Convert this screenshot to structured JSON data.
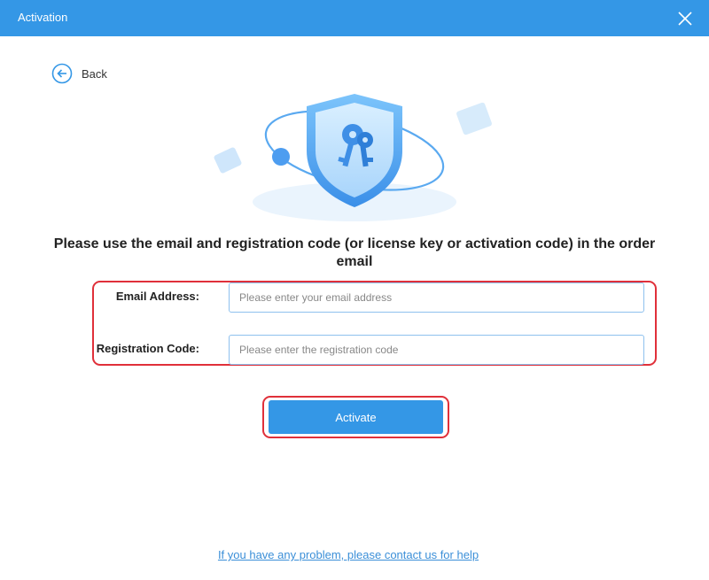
{
  "window": {
    "title": "Activation",
    "close_icon": "close-icon"
  },
  "nav": {
    "back_label": "Back",
    "back_icon": "arrow-left-circle-icon"
  },
  "illustration": {
    "icon": "shield-key-icon",
    "colors": {
      "shield": "#4aa3f2",
      "accent": "#3497e6"
    }
  },
  "heading": "Please use the email and registration code (or license key or activation code) in the order email",
  "form": {
    "email": {
      "label": "Email Address:",
      "value": "",
      "placeholder": "Please enter your email address"
    },
    "registration_code": {
      "label": "Registration Code:",
      "value": "",
      "placeholder": "Please enter the registration code"
    }
  },
  "activate_button": "Activate",
  "help_link": "If you have any problem, please contact us for help",
  "colors": {
    "titlebar": "#3497e6",
    "button": "#3497e6",
    "highlight": "#e0303a",
    "link": "#3b8fd8"
  }
}
